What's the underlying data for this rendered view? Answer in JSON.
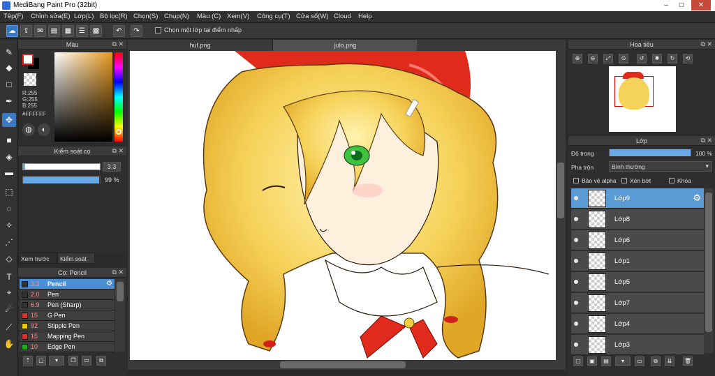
{
  "window": {
    "title": "MediBang Paint Pro (32bit)",
    "controls": {
      "minimize": "–",
      "maximize": "□",
      "close": "✕"
    }
  },
  "menubar": {
    "items": [
      "Tệp(F)",
      "Chỉnh sửa(E)",
      "Lớp(L)",
      "Bộ lọc(R)",
      "Chọn(S)",
      "Chụp(N)",
      "Màu (C)",
      "Xem(V)",
      "Công cụ(T)",
      "Cửa sổ(W)",
      "Cloud",
      "Help"
    ]
  },
  "toolbar": {
    "checkbox_label": "Chọn một lớp tại điểm nhấp",
    "checkbox_checked": false
  },
  "color_panel": {
    "title": "Màu",
    "rgb": [
      "R:255",
      "G:255",
      "B:255"
    ],
    "hex": "#FFFFFF"
  },
  "brush_control_panel": {
    "title": "Kiểm soát cọ",
    "size_value": "3.3",
    "opacity_value": "99 %",
    "opacity_percent": 99
  },
  "subtabs": [
    "Xem trước cọ",
    "Kiểm soát cọ"
  ],
  "brush_panel": {
    "title": "Cọ: Pencil",
    "brushes": [
      {
        "size": "3.3",
        "name": "Pencil",
        "color": "#333333",
        "active": true
      },
      {
        "size": "2.0",
        "name": "Pen",
        "color": "#333333",
        "active": false
      },
      {
        "size": "6.9",
        "name": "Pen (Sharp)",
        "color": "#333333",
        "active": false
      },
      {
        "size": "15",
        "name": "G Pen",
        "color": "#e03030",
        "active": false
      },
      {
        "size": "92",
        "name": "Stipple Pen",
        "color": "#e8d000",
        "active": false
      },
      {
        "size": "15",
        "name": "Mapping Pen",
        "color": "#e03030",
        "active": false
      },
      {
        "size": "10",
        "name": "Edge Pen",
        "color": "#20b020",
        "active": false
      }
    ]
  },
  "document_tabs": [
    {
      "label": "huf.png",
      "active": false
    },
    {
      "label": "julo.png",
      "active": true
    }
  ],
  "navigator_panel": {
    "title": "Hoa tiêu"
  },
  "layer_panel": {
    "title": "Lớp",
    "opacity_label": "Độ trong",
    "opacity_value": "100 %",
    "opacity_percent": 100,
    "blend_label": "Pha trộn",
    "blend_value": "Bình thường",
    "options": [
      "Bảo vệ alpha",
      "Xén bớt",
      "Khóa"
    ],
    "layers": [
      {
        "name": "Lớp9",
        "active": true
      },
      {
        "name": "Lớp8",
        "active": false
      },
      {
        "name": "Lớp6",
        "active": false
      },
      {
        "name": "Lớp1",
        "active": false
      },
      {
        "name": "Lớp5",
        "active": false
      },
      {
        "name": "Lớp7",
        "active": false
      },
      {
        "name": "Lớp4",
        "active": false
      },
      {
        "name": "Lớp3",
        "active": false
      }
    ]
  },
  "colors": {
    "accent": "#3a78c0",
    "layer_active": "#5b9bd5",
    "brush_active": "#4a8fd6",
    "panel_bg": "#2e2e2e"
  }
}
